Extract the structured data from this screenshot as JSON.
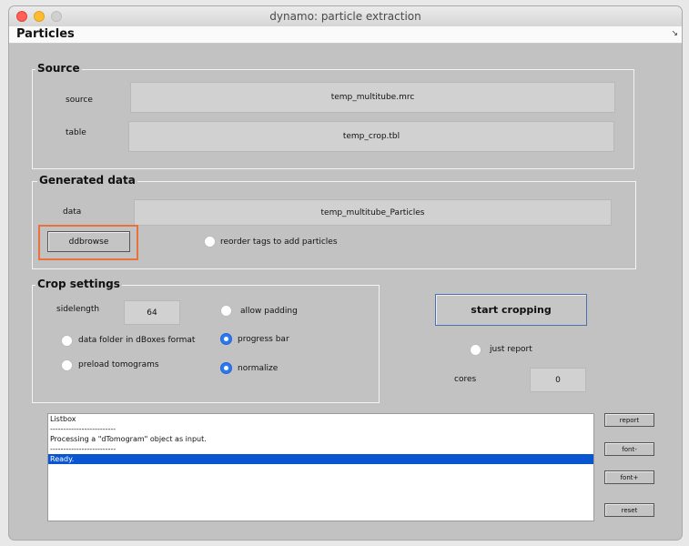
{
  "window": {
    "title": "dynamo: particle extraction"
  },
  "menubar": {
    "label": "Particles",
    "arrow": "↘"
  },
  "source": {
    "title": "Source",
    "source_label": "source",
    "source_value": "temp_multitube.mrc",
    "table_label": "table",
    "table_value": "temp_crop.tbl"
  },
  "generated": {
    "title": "Generated data",
    "data_label": "data",
    "data_value": "temp_multitube_Particles",
    "ddbrowse_label": "ddbrowse",
    "reorder_label": "reorder tags to add particles"
  },
  "crop": {
    "title": "Crop settings",
    "sidelength_label": "sidelength",
    "sidelength_value": "64",
    "allow_padding": "allow padding",
    "data_folder": "data folder in dBoxes format",
    "progress_bar": "progress bar",
    "preload": "preload tomograms",
    "normalize": "normalize"
  },
  "actions": {
    "start_label": "start cropping",
    "just_report": "just report",
    "cores_label": "cores",
    "cores_value": "0"
  },
  "listbox": {
    "lines": [
      "Listbox",
      "-------------------------",
      "Processing a \"dTomogram\" object as input.",
      "-------------------------",
      "Ready."
    ]
  },
  "side_buttons": {
    "report": "report",
    "font_minus": "font-",
    "font_plus": "font+",
    "reset": "reset"
  },
  "colors": {
    "accent": "#2b78f3",
    "selection": "#0a56d1",
    "highlight": "#e8713d"
  }
}
